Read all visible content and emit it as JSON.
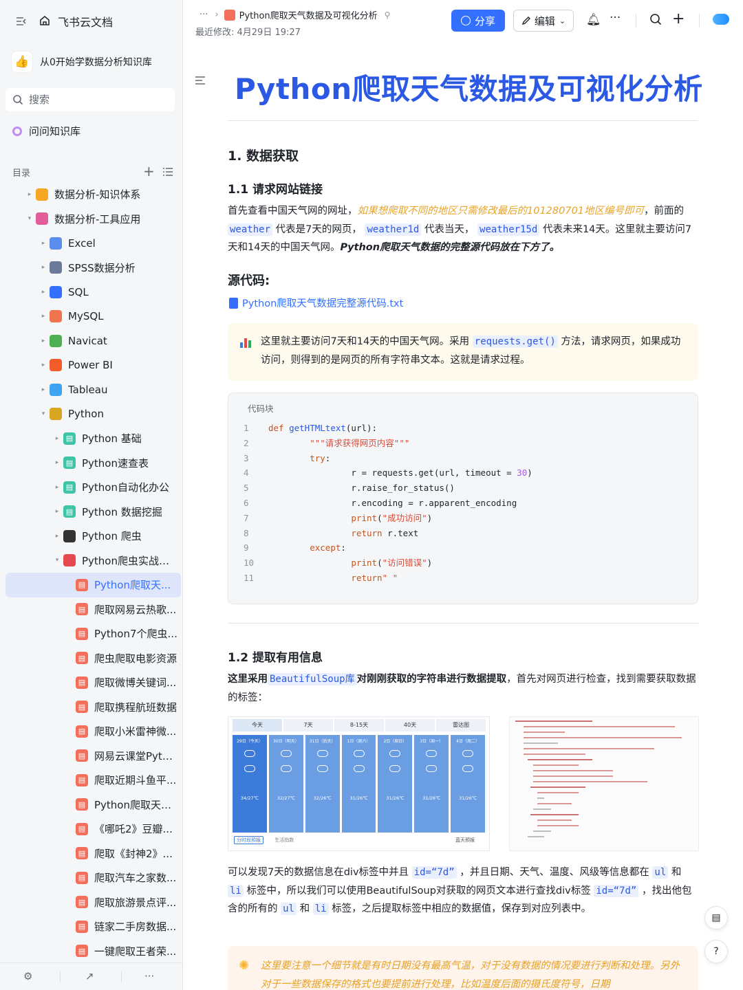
{
  "sidebar": {
    "brand": "飞书云文档",
    "kb_name": "从0开始学数据分析知识库",
    "search_placeholder": "搜索",
    "ask_label": "问问知识库",
    "toc_label": "目录",
    "tree": [
      {
        "label": "数据分析-知识体系",
        "level": 0,
        "arrow": "▸",
        "icon": "folder-icon",
        "color": "#f5a623"
      },
      {
        "label": "数据分析-工具应用",
        "level": 0,
        "arrow": "▾",
        "icon": "folder-icon",
        "color": "#e45d9b"
      },
      {
        "label": "Excel",
        "level": 1,
        "arrow": "▸",
        "icon": "chart-icon",
        "color": "#5b8def"
      },
      {
        "label": "SPSS数据分析",
        "level": 1,
        "arrow": "▸",
        "icon": "grid-icon",
        "color": "#6b7a99"
      },
      {
        "label": "SQL",
        "level": 1,
        "arrow": "▸",
        "icon": "target-icon",
        "color": "#3370ff"
      },
      {
        "label": "MySQL",
        "level": 1,
        "arrow": "▸",
        "icon": "dot-icon",
        "color": "#f0744e"
      },
      {
        "label": "Navicat",
        "level": 1,
        "arrow": "▸",
        "icon": "image-icon",
        "color": "#4caf50"
      },
      {
        "label": "Power BI",
        "level": 1,
        "arrow": "▸",
        "icon": "fire-icon",
        "color": "#f25c29"
      },
      {
        "label": "Tableau",
        "level": 1,
        "arrow": "▸",
        "icon": "drop-icon",
        "color": "#3ea3f0"
      },
      {
        "label": "Python",
        "level": 1,
        "arrow": "▾",
        "icon": "snake-icon",
        "color": "#d9a622"
      },
      {
        "label": "Python 基础",
        "level": 2,
        "arrow": "▸",
        "icon": "doc-icon",
        "color": "#3ec5a8"
      },
      {
        "label": "Python速查表",
        "level": 2,
        "arrow": "▸",
        "icon": "doc-icon",
        "color": "#3ec5a8"
      },
      {
        "label": "Python自动化办公",
        "level": 2,
        "arrow": "▸",
        "icon": "doc-icon",
        "color": "#3ec5a8"
      },
      {
        "label": "Python 数据挖掘",
        "level": 2,
        "arrow": "▸",
        "icon": "doc-icon",
        "color": "#3ec5a8"
      },
      {
        "label": "Python 爬虫",
        "level": 2,
        "arrow": "▸",
        "icon": "spider-icon",
        "color": "#333333"
      },
      {
        "label": "Python爬虫实战案例",
        "level": 2,
        "arrow": "▾",
        "icon": "target-icon",
        "color": "#e5484d"
      },
      {
        "label": "Python爬取天...",
        "level": 3,
        "arrow": "",
        "icon": "doc-icon",
        "color": "#f46f5b",
        "active": true
      },
      {
        "label": "爬取网易云热歌...",
        "level": 3,
        "arrow": "",
        "icon": "doc-icon",
        "color": "#f46f5b"
      },
      {
        "label": "Python7个爬虫...",
        "level": 3,
        "arrow": "",
        "icon": "doc-icon",
        "color": "#f46f5b"
      },
      {
        "label": "爬虫爬取电影资源",
        "level": 3,
        "arrow": "",
        "icon": "doc-icon",
        "color": "#f46f5b"
      },
      {
        "label": "爬取微博关键词...",
        "level": 3,
        "arrow": "",
        "icon": "doc-icon",
        "color": "#f46f5b"
      },
      {
        "label": "爬取携程航班数据",
        "level": 3,
        "arrow": "",
        "icon": "doc-icon",
        "color": "#f46f5b"
      },
      {
        "label": "爬取小米雷神微...",
        "level": 3,
        "arrow": "",
        "icon": "doc-icon",
        "color": "#f46f5b"
      },
      {
        "label": "网易云课堂Pyth...",
        "level": 3,
        "arrow": "",
        "icon": "doc-icon",
        "color": "#f46f5b"
      },
      {
        "label": "爬取近期斗鱼平...",
        "level": 3,
        "arrow": "",
        "icon": "doc-icon",
        "color": "#f46f5b"
      },
      {
        "label": "Python爬取天气...",
        "level": 3,
        "arrow": "",
        "icon": "doc-icon",
        "color": "#f46f5b"
      },
      {
        "label": "《哪吒2》豆瓣...",
        "level": 3,
        "arrow": "",
        "icon": "doc-icon",
        "color": "#f46f5b"
      },
      {
        "label": "爬取《封神2》...",
        "level": 3,
        "arrow": "",
        "icon": "doc-icon",
        "color": "#f46f5b"
      },
      {
        "label": "爬取汽车之家数...",
        "level": 3,
        "arrow": "",
        "icon": "doc-icon",
        "color": "#f46f5b"
      },
      {
        "label": "爬取旅游景点评...",
        "level": 3,
        "arrow": "",
        "icon": "doc-icon",
        "color": "#f46f5b"
      },
      {
        "label": "链家二手房数据...",
        "level": 3,
        "arrow": "",
        "icon": "doc-icon",
        "color": "#f46f5b"
      },
      {
        "label": "一键爬取王者荣...",
        "level": 3,
        "arrow": "",
        "icon": "doc-icon",
        "color": "#f46f5b"
      }
    ]
  },
  "header": {
    "breadcrumb_more": "···",
    "doc_name": "Python爬取天气数据及可视化分析",
    "modified": "最近修改: 4月29日 19:27",
    "share_label": "分享",
    "edit_label": "编辑"
  },
  "doc": {
    "title": "Python爬取天气数据及可视化分析",
    "h1": "1. 数据获取",
    "h11": "1.1 请求网站链接",
    "p1_a": "首先查看中国天气网的网址，",
    "p1_hl": "如果想爬取不同的地区只需修改最后的101280701地区编号即可",
    "p1_b": "，前面的",
    "p1_c1": "weather",
    "p1_c": "代表是7天的网页，",
    "p1_c2": "weather1d",
    "p1_d": "代表当天，",
    "p1_c3": "weather15d",
    "p1_e": "代表未来14天。这里就主要访问7天和14天的中国天气网。",
    "p1_bold": "Python爬取天气数据的完整源代码放在下方了。",
    "src_heading": "源代码:",
    "file_link": "Python爬取天气数据完整源代码.txt",
    "callout_a": "这里就主要访问7天和14天的中国天气网。采用",
    "callout_code": "requests.get()",
    "callout_b": "方法，请求网页，如果成功访问，则得到的是网页的所有字符串文本。这就是请求过程。",
    "code_label": "代码块",
    "h12": "1.2 提取有用信息",
    "p2_a": "这里采用",
    "p2_code": "BeautifulSoup库",
    "p2_b": "对刚刚获取的字符串进行数据提取",
    "p2_c": "，首先对网页进行检查，找到需要获取数据的标签：",
    "p3_a": "可以发现7天的数据信息在div标签中并且",
    "p3_c1": "id=“7d”",
    "p3_b": "，并且日期、天气、温度、风级等信息都在",
    "p3_c2": "ul",
    "p3_and1": "和",
    "p3_c3": "li",
    "p3_c": "标签中，所以我们可以使用BeautifulSoup对获取的网页文本进行查找div标签",
    "p3_c4": "id=“7d”",
    "p3_d": "，找出他包含的所有的",
    "p3_c5": "ul",
    "p3_and2": "和",
    "p3_c6": "li",
    "p3_e": "标签，之后提取标签中相应的数据值，保存到对应列表中。",
    "callout2": "这里要注意一个细节就是有时日期没有最高气温，对于没有数据的情况要进行判断和处理。另外对于一些数据保存的格式也要提前进行处理，比如温度后面的摄氏度符号，日期"
  },
  "weather_shot": {
    "tabs": [
      "今天",
      "7天",
      "8-15天",
      "40天",
      "雷达图"
    ],
    "days": [
      "29日（今天）",
      "30日（明天）",
      "31日（后天）",
      "1日（周六）",
      "2日（周日）",
      "3日（周一）",
      "4日（周二）"
    ],
    "temps": [
      "34/27℃",
      "32/27℃",
      "32/26℃",
      "31/26℃",
      "31/26℃",
      "31/26℃",
      "31/26℃"
    ],
    "footer_a": "分时段预报",
    "footer_b": "生活指数",
    "footer_c": "蓝天预报"
  },
  "code_lines": [
    [
      [
        "kw",
        "def "
      ],
      [
        "fn",
        "getHTMLtext"
      ],
      [
        "",
        "(url):"
      ]
    ],
    [
      [
        "",
        "        "
      ],
      [
        "st",
        "\"\"\"请求获得网页内容\"\"\""
      ]
    ],
    [
      [
        "",
        "        "
      ],
      [
        "kw",
        "try"
      ],
      [
        "",
        ":"
      ]
    ],
    [
      [
        "",
        "                r = requests.get(url, timeout = "
      ],
      [
        "nm",
        "30"
      ],
      [
        "",
        ")"
      ]
    ],
    [
      [
        "",
        "                r.raise_for_status()"
      ]
    ],
    [
      [
        "",
        "                r.encoding = r.apparent_encoding"
      ]
    ],
    [
      [
        "",
        "                "
      ],
      [
        "kw",
        "print"
      ],
      [
        "",
        "("
      ],
      [
        "st",
        "\"成功访问\""
      ],
      [
        "",
        ")"
      ]
    ],
    [
      [
        "",
        "                "
      ],
      [
        "kw",
        "return"
      ],
      [
        "",
        " r.text"
      ]
    ],
    [
      [
        "",
        "        "
      ],
      [
        "kw",
        "except"
      ],
      [
        "",
        ":"
      ]
    ],
    [
      [
        "",
        "                "
      ],
      [
        "kw",
        "print"
      ],
      [
        "",
        "("
      ],
      [
        "st",
        "\"访问错误\""
      ],
      [
        "",
        ")"
      ]
    ],
    [
      [
        "",
        "                "
      ],
      [
        "kw",
        "return"
      ],
      [
        "st",
        "\" \""
      ]
    ]
  ],
  "sidebar_bottom": [
    "⚙",
    "↗",
    "···"
  ]
}
